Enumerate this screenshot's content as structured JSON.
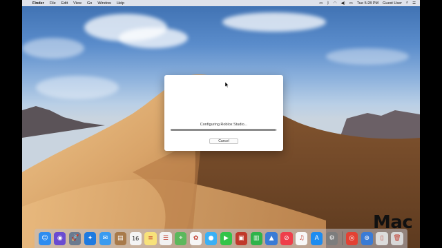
{
  "menubar": {
    "apple": "",
    "items": [
      "Finder",
      "File",
      "Edit",
      "View",
      "Go",
      "Window",
      "Help"
    ],
    "clock": "Tue 5:28 PM",
    "user": "Guest User"
  },
  "dialog": {
    "status": "Configuring Roblox Studio...",
    "progress": 0.99,
    "cancel_label": "Cancel"
  },
  "dock": {
    "icons": [
      {
        "name": "finder",
        "glyph": "☺",
        "color": "#2d8cf0"
      },
      {
        "name": "siri",
        "glyph": "◉",
        "color": "#6a4bd1"
      },
      {
        "name": "launchpad",
        "glyph": "🚀",
        "color": "#6b7a8f"
      },
      {
        "name": "safari",
        "glyph": "✦",
        "color": "#1e7ae0"
      },
      {
        "name": "mail",
        "glyph": "✉",
        "color": "#3a9bf0"
      },
      {
        "name": "contacts",
        "glyph": "▤",
        "color": "#a87a4a"
      },
      {
        "name": "calendar",
        "glyph": "16",
        "color": "#f4f4f4"
      },
      {
        "name": "notes",
        "glyph": "≡",
        "color": "#f8e27a"
      },
      {
        "name": "reminders",
        "glyph": "☰",
        "color": "#f2f2f2"
      },
      {
        "name": "maps",
        "glyph": "⌖",
        "color": "#5cb85c"
      },
      {
        "name": "photos",
        "glyph": "✿",
        "color": "#f6f6f6"
      },
      {
        "name": "messages",
        "glyph": "●",
        "color": "#3ab0f5"
      },
      {
        "name": "facetime",
        "glyph": "▶",
        "color": "#33c448"
      },
      {
        "name": "photo-booth",
        "glyph": "▣",
        "color": "#c0392b"
      },
      {
        "name": "numbers",
        "glyph": "▥",
        "color": "#2fb34a"
      },
      {
        "name": "keynote",
        "glyph": "▲",
        "color": "#3a7bd5"
      },
      {
        "name": "news",
        "glyph": "⊘",
        "color": "#ef3e4a"
      },
      {
        "name": "music",
        "glyph": "♫",
        "color": "#f7f7f7"
      },
      {
        "name": "app-store",
        "glyph": "A",
        "color": "#1d8cf0"
      },
      {
        "name": "system-preferences",
        "glyph": "⚙",
        "color": "#7d7d7d"
      },
      {
        "name": "chrome",
        "glyph": "◎",
        "color": "#e34133"
      },
      {
        "name": "downloads",
        "glyph": "⊕",
        "color": "#3a7bd5"
      },
      {
        "name": "documents",
        "glyph": "▯",
        "color": "#dcdcdc"
      },
      {
        "name": "trash",
        "glyph": "🗑",
        "color": "#d8d8d8"
      }
    ]
  },
  "watermark": "Mac"
}
